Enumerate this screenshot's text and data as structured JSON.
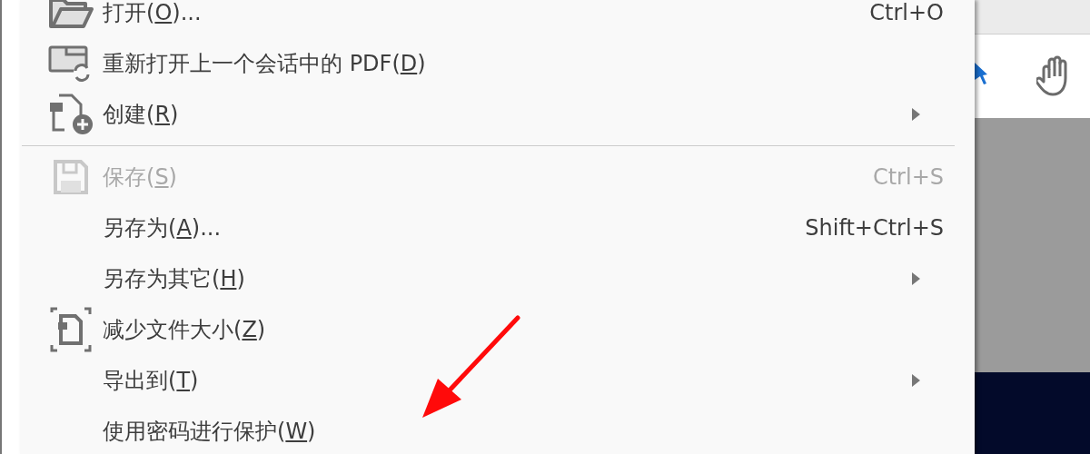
{
  "menu": {
    "items": [
      {
        "kind": "item",
        "before": "打开(",
        "accelerator": "O",
        "after": ")...",
        "shortcut": "Ctrl+O",
        "disabled": false,
        "has_submenu": false
      },
      {
        "kind": "item",
        "before": "重新打开上一个会话中的 PDF(",
        "accelerator": "D",
        "after": ")",
        "disabled": false,
        "has_submenu": false
      },
      {
        "kind": "item",
        "before": "创建(",
        "accelerator": "R",
        "after": ")",
        "disabled": false,
        "has_submenu": true
      },
      {
        "kind": "separator"
      },
      {
        "kind": "item",
        "before": "保存(",
        "accelerator": "S",
        "after": ")",
        "shortcut": "Ctrl+S",
        "disabled": true,
        "has_submenu": false
      },
      {
        "kind": "item",
        "before": "另存为(",
        "accelerator": "A",
        "after": ")...",
        "shortcut": "Shift+Ctrl+S",
        "disabled": false,
        "has_submenu": false
      },
      {
        "kind": "item",
        "before": "另存为其它(",
        "accelerator": "H",
        "after": ")",
        "disabled": false,
        "has_submenu": true
      },
      {
        "kind": "item",
        "before": "减少文件大小(",
        "accelerator": "Z",
        "after": ")",
        "disabled": false,
        "has_submenu": false
      },
      {
        "kind": "item",
        "before": "导出到(",
        "accelerator": "T",
        "after": ")",
        "disabled": false,
        "has_submenu": true
      },
      {
        "kind": "item",
        "before": "使用密码进行保护(",
        "accelerator": "W",
        "after": ")",
        "disabled": false,
        "has_submenu": false
      }
    ]
  }
}
